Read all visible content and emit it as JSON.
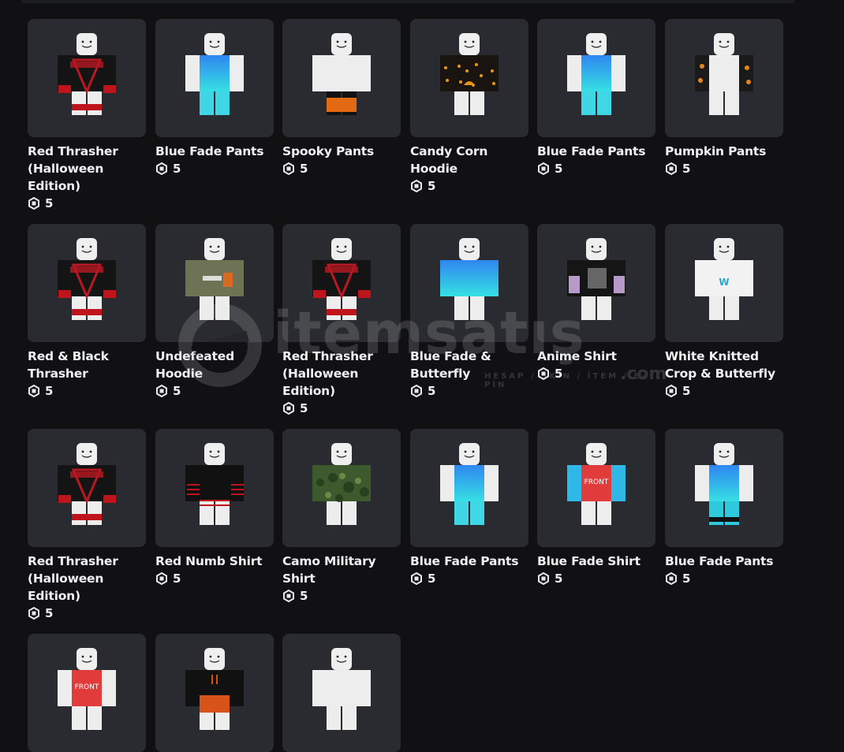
{
  "colors": {
    "accent": "#ffffff",
    "card_bg": "#2a2b30",
    "page_bg": "#111114"
  },
  "price_icon": "robux-icon",
  "watermark": {
    "brand": "itemsatış",
    "tagline": "HESAP / SKİN / İTEM / E-PİN",
    "suffix": ".com"
  },
  "items": [
    {
      "name": "Red Thrasher (Halloween Edition)",
      "price": "5",
      "style": "thrasher"
    },
    {
      "name": "Blue Fade Pants",
      "price": "5",
      "style": "bluefade-pants"
    },
    {
      "name": "Spooky Pants",
      "price": "5",
      "style": "spooky-pants"
    },
    {
      "name": "Candy Corn Hoodie",
      "price": "5",
      "style": "candycorn"
    },
    {
      "name": "Blue Fade Pants",
      "price": "5",
      "style": "bluefade-pants"
    },
    {
      "name": "Pumpkin Pants",
      "price": "5",
      "style": "pumpkin"
    },
    {
      "name": "Red & Black Thrasher",
      "price": "5",
      "style": "thrasher"
    },
    {
      "name": "Undefeated Hoodie",
      "price": "5",
      "style": "undefeated"
    },
    {
      "name": "Red Thrasher (Halloween Edition)",
      "price": "5",
      "style": "thrasher"
    },
    {
      "name": "Blue Fade & Butterfly",
      "price": "5",
      "style": "bluefade-shirt"
    },
    {
      "name": "Anime Shirt",
      "price": "5",
      "style": "anime"
    },
    {
      "name": "White Knitted Crop & Butterfly",
      "price": "5",
      "style": "whiteknit"
    },
    {
      "name": "Red Thrasher (Halloween Edition)",
      "price": "5",
      "style": "thrasher"
    },
    {
      "name": "Red Numb Shirt",
      "price": "5",
      "style": "numb"
    },
    {
      "name": "Camo Military Shirt",
      "price": "5",
      "style": "camo"
    },
    {
      "name": "Blue Fade Pants",
      "price": "5",
      "style": "bluefade-pants"
    },
    {
      "name": "Blue Fade Shirt",
      "price": "5",
      "style": "front"
    },
    {
      "name": "Blue Fade Pants",
      "price": "5",
      "style": "bluefade-pants2"
    },
    {
      "name": "",
      "price": "",
      "style": "front-red"
    },
    {
      "name": "",
      "price": "",
      "style": "orangehoodie"
    },
    {
      "name": "",
      "price": "",
      "style": "plain"
    }
  ]
}
